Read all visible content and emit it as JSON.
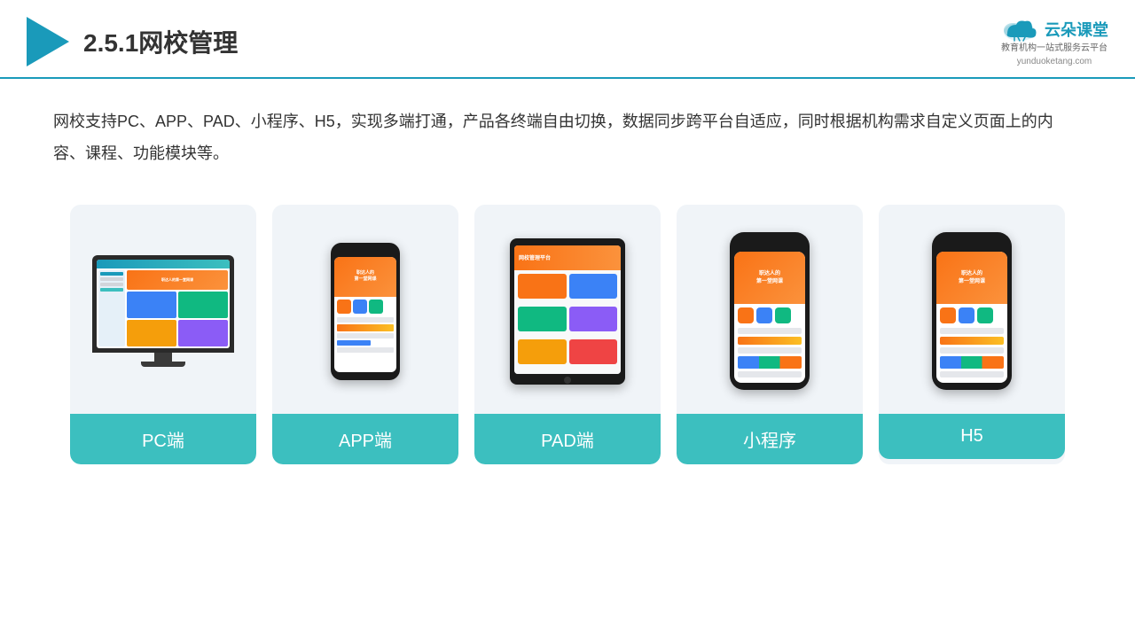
{
  "header": {
    "title": "2.5.1网校管理",
    "logo_name": "云朵课堂",
    "logo_url": "yunduoketang.com",
    "logo_subtitle": "教育机构一站\n式服务云平台"
  },
  "description": {
    "text": "网校支持PC、APP、PAD、小程序、H5，实现多端打通，产品各终端自由切换，数据同步跨平台自适应，同时根据机构需求自定义页面上的内容、课程、功能模块等。"
  },
  "cards": [
    {
      "id": "pc",
      "label": "PC端"
    },
    {
      "id": "app",
      "label": "APP端"
    },
    {
      "id": "pad",
      "label": "PAD端"
    },
    {
      "id": "mini",
      "label": "小程序"
    },
    {
      "id": "h5",
      "label": "H5"
    }
  ],
  "colors": {
    "accent": "#1a9aba",
    "card_label_bg": "#3cbfbf",
    "card_bg": "#f0f4f8"
  }
}
